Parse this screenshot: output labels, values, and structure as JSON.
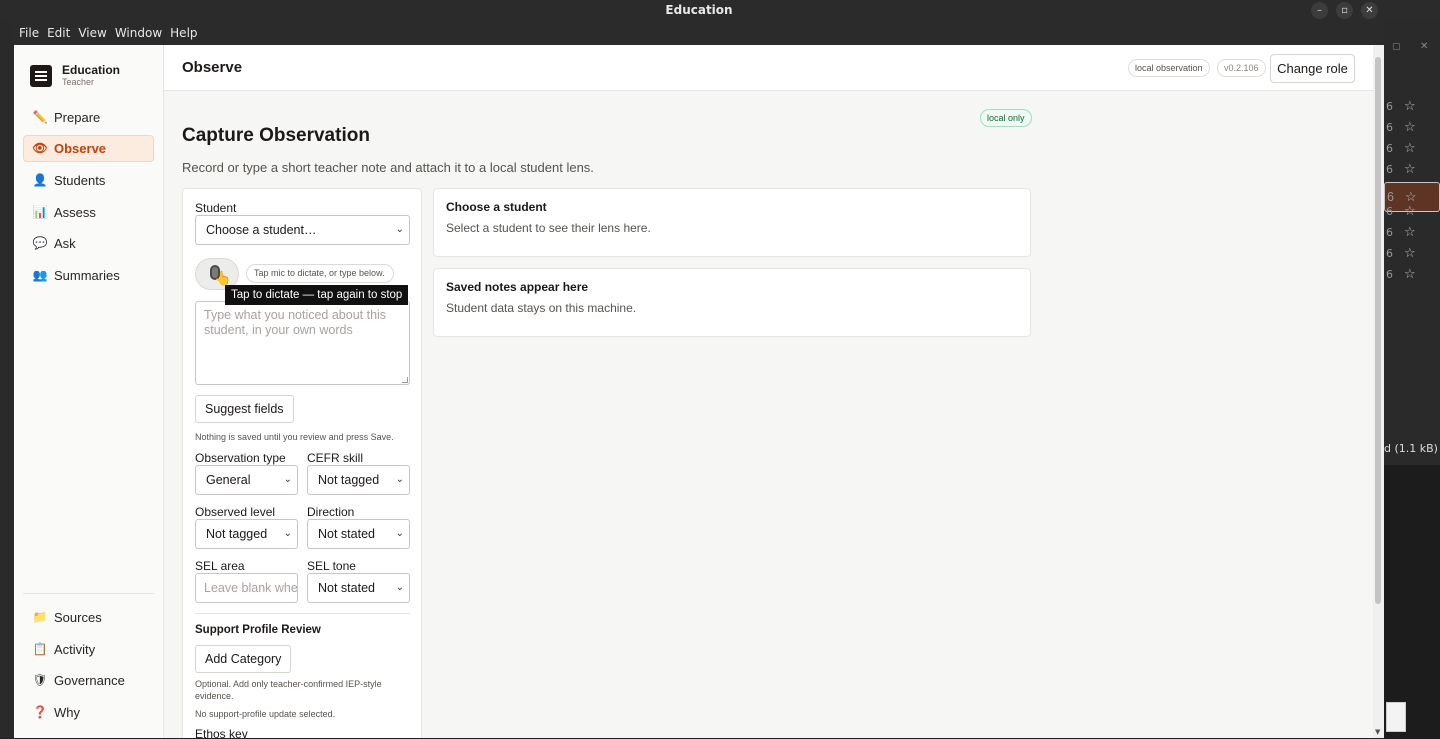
{
  "window": {
    "title": "Education"
  },
  "menu": [
    "File",
    "Edit",
    "View",
    "Window",
    "Help"
  ],
  "brand": {
    "name": "Education",
    "role": "Teacher"
  },
  "nav": [
    {
      "label": "Prepare",
      "icon": "pencil-icon",
      "glyph": "✏️"
    },
    {
      "label": "Observe",
      "icon": "eye-icon",
      "glyph": "👁"
    },
    {
      "label": "Students",
      "icon": "person-icon",
      "glyph": "👤"
    },
    {
      "label": "Assess",
      "icon": "bar-chart-icon",
      "glyph": "📊"
    },
    {
      "label": "Ask",
      "icon": "speech-bubble-icon",
      "glyph": "💬"
    },
    {
      "label": "Summaries",
      "icon": "people-icon",
      "glyph": "👥"
    }
  ],
  "nav_bottom": [
    {
      "label": "Sources",
      "icon": "folder-icon",
      "glyph": "📁"
    },
    {
      "label": "Activity",
      "icon": "clipboard-icon",
      "glyph": "📋"
    },
    {
      "label": "Governance",
      "icon": "shield-icon",
      "glyph": "🛡"
    },
    {
      "label": "Why",
      "icon": "question-icon",
      "glyph": "❓"
    }
  ],
  "header": {
    "title": "Observe",
    "badge_mode": "local observation",
    "version": "v0.2.106",
    "change_role": "Change role"
  },
  "page": {
    "heading": "Capture Observation",
    "subtitle": "Record or type a short teacher note and attach it to a local student lens.",
    "local_badge": "local only"
  },
  "form": {
    "student_label": "Student",
    "student_value": "Choose a student…",
    "mic_hint": "Tap mic to dictate, or type below.",
    "mic_tooltip": "Tap to dictate — tap again to stop",
    "note_placeholder": "Type what you noticed about this student, in your own words",
    "suggest_button": "Suggest fields",
    "save_hint": "Nothing is saved until you review and press Save.",
    "obs_type_label": "Observation type",
    "obs_type_value": "General",
    "cefr_label": "CEFR skill",
    "cefr_value": "Not tagged",
    "level_label": "Observed level",
    "level_value": "Not tagged",
    "direction_label": "Direction",
    "direction_value": "Not stated",
    "sel_area_label": "SEL area",
    "sel_area_placeholder": "Leave blank when unsure",
    "sel_tone_label": "SEL tone",
    "sel_tone_value": "Not stated",
    "support_heading": "Support Profile Review",
    "add_category": "Add Category",
    "support_hint": "Optional. Add only teacher-confirmed IEP-style evidence.",
    "support_status": "No support-profile update selected.",
    "ethos_label": "Ethos key"
  },
  "cards": {
    "student_title": "Choose a student",
    "student_sub": "Select a student to see their lens here.",
    "notes_title": "Saved notes appear here",
    "notes_sub": "Student data stays on this machine."
  },
  "background_window": {
    "size_label": "d (1.1 kB)",
    "row_numbers": [
      "6",
      "6",
      "6",
      "6",
      "6",
      "6",
      "6",
      "6",
      "6"
    ]
  }
}
